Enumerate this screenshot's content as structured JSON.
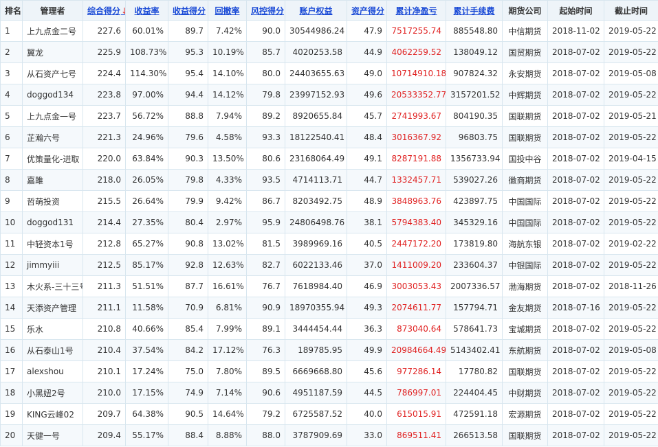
{
  "header": {
    "rank": "排名",
    "manager": "管理者",
    "composite_score": "综合得分",
    "return_rate": "收益率",
    "return_score": "收益得分",
    "drawdown": "回撤率",
    "risk_score": "风控得分",
    "equity": "账户权益",
    "asset_score": "资产得分",
    "net_pnl": "累计净盈亏",
    "fees": "累计手续费",
    "broker": "期货公司",
    "start": "起始时间",
    "end": "截止时间",
    "sort_arrow": "↓"
  },
  "rows": [
    [
      "1",
      "上九点金二号",
      "227.6",
      "60.01%",
      "89.7",
      "7.42%",
      "90.0",
      "30544986.24",
      "47.9",
      "7517255.74",
      "885548.80",
      "中信期货",
      "2018-11-02",
      "2019-05-22"
    ],
    [
      "2",
      "翼龙",
      "225.9",
      "108.73%",
      "95.3",
      "10.19%",
      "85.7",
      "4020253.58",
      "44.9",
      "4062259.52",
      "138049.12",
      "国贸期货",
      "2018-07-02",
      "2019-05-22"
    ],
    [
      "3",
      "从石资产七号",
      "224.4",
      "114.30%",
      "95.4",
      "14.10%",
      "80.0",
      "24403655.63",
      "49.0",
      "10714910.18",
      "907824.32",
      "永安期货",
      "2018-07-02",
      "2019-05-08"
    ],
    [
      "4",
      "doggod134",
      "223.8",
      "97.00%",
      "94.4",
      "14.12%",
      "79.8",
      "23997152.93",
      "49.6",
      "20533352.77",
      "3157201.52",
      "中辉期货",
      "2018-07-02",
      "2019-05-22"
    ],
    [
      "5",
      "上九点金一号",
      "223.7",
      "56.72%",
      "88.8",
      "7.94%",
      "89.2",
      "8920655.84",
      "45.7",
      "2741993.67",
      "804190.35",
      "国联期货",
      "2018-07-02",
      "2019-05-21"
    ],
    [
      "6",
      "芷瀚六号",
      "221.3",
      "24.96%",
      "79.6",
      "4.58%",
      "93.3",
      "18122540.41",
      "48.4",
      "3016367.92",
      "96803.75",
      "国联期货",
      "2018-07-02",
      "2019-05-22"
    ],
    [
      "7",
      "优策量化-进取",
      "220.0",
      "63.84%",
      "90.3",
      "13.50%",
      "80.6",
      "23168064.49",
      "49.1",
      "8287191.88",
      "1356733.94",
      "国投中谷",
      "2018-07-02",
      "2019-04-15"
    ],
    [
      "8",
      "嘉雎",
      "218.0",
      "26.05%",
      "79.8",
      "4.33%",
      "93.5",
      "4714113.71",
      "44.7",
      "1332457.71",
      "539027.26",
      "徽商期货",
      "2018-07-02",
      "2019-05-22"
    ],
    [
      "9",
      "哲萌投资",
      "215.5",
      "26.64%",
      "79.9",
      "9.42%",
      "86.7",
      "8203492.75",
      "48.9",
      "3848963.76",
      "423897.75",
      "中国国际",
      "2018-07-02",
      "2019-05-22"
    ],
    [
      "10",
      "doggod131",
      "214.4",
      "27.35%",
      "80.4",
      "2.97%",
      "95.9",
      "24806498.76",
      "38.1",
      "5794383.40",
      "345329.16",
      "中国国际",
      "2018-07-02",
      "2019-05-22"
    ],
    [
      "11",
      "中轻资本1号",
      "212.8",
      "65.27%",
      "90.8",
      "13.02%",
      "81.5",
      "3989969.16",
      "40.5",
      "2447172.20",
      "173819.80",
      "海航东银",
      "2018-07-02",
      "2019-02-22"
    ],
    [
      "12",
      "jimmyiii",
      "212.5",
      "85.17%",
      "92.8",
      "12.63%",
      "82.7",
      "6022133.46",
      "37.0",
      "1411009.20",
      "233604.37",
      "中银国际",
      "2018-07-02",
      "2019-05-22"
    ],
    [
      "13",
      "木火系-三十三号",
      "211.3",
      "51.51%",
      "87.7",
      "16.61%",
      "76.7",
      "7618984.40",
      "46.9",
      "3003053.43",
      "2007336.57",
      "渤海期货",
      "2018-07-02",
      "2018-11-26"
    ],
    [
      "14",
      "天添资产管理",
      "211.1",
      "11.58%",
      "70.9",
      "6.81%",
      "90.9",
      "18970355.94",
      "49.3",
      "2074611.77",
      "157794.71",
      "金友期货",
      "2018-07-16",
      "2019-05-22"
    ],
    [
      "15",
      "乐水",
      "210.8",
      "40.66%",
      "85.4",
      "7.99%",
      "89.1",
      "3444454.44",
      "36.3",
      "873040.64",
      "578641.73",
      "宝城期货",
      "2018-07-02",
      "2019-05-22"
    ],
    [
      "16",
      "从石泰山1号",
      "210.4",
      "37.54%",
      "84.2",
      "17.12%",
      "76.3",
      "189785.95",
      "49.9",
      "20984664.49",
      "5143402.41",
      "东航期货",
      "2018-07-02",
      "2019-05-08"
    ],
    [
      "17",
      "alexshou",
      "210.1",
      "17.24%",
      "75.0",
      "7.80%",
      "89.5",
      "6669668.80",
      "45.6",
      "977286.14",
      "17780.82",
      "国联期货",
      "2018-07-02",
      "2019-05-22"
    ],
    [
      "18",
      "小黑妞2号",
      "210.0",
      "17.15%",
      "74.9",
      "7.14%",
      "90.6",
      "4951187.59",
      "44.5",
      "786997.01",
      "224404.45",
      "中财期货",
      "2018-07-02",
      "2019-05-22"
    ],
    [
      "19",
      "KING云峰02",
      "209.7",
      "64.38%",
      "90.5",
      "14.64%",
      "79.2",
      "6725587.52",
      "40.0",
      "615015.91",
      "472591.18",
      "宏源期货",
      "2018-07-02",
      "2019-05-22"
    ],
    [
      "20",
      "天健一号",
      "209.4",
      "55.17%",
      "88.4",
      "8.88%",
      "88.0",
      "3787909.69",
      "33.0",
      "869511.41",
      "266513.58",
      "国联期货",
      "2018-07-02",
      "2019-05-22"
    ]
  ]
}
